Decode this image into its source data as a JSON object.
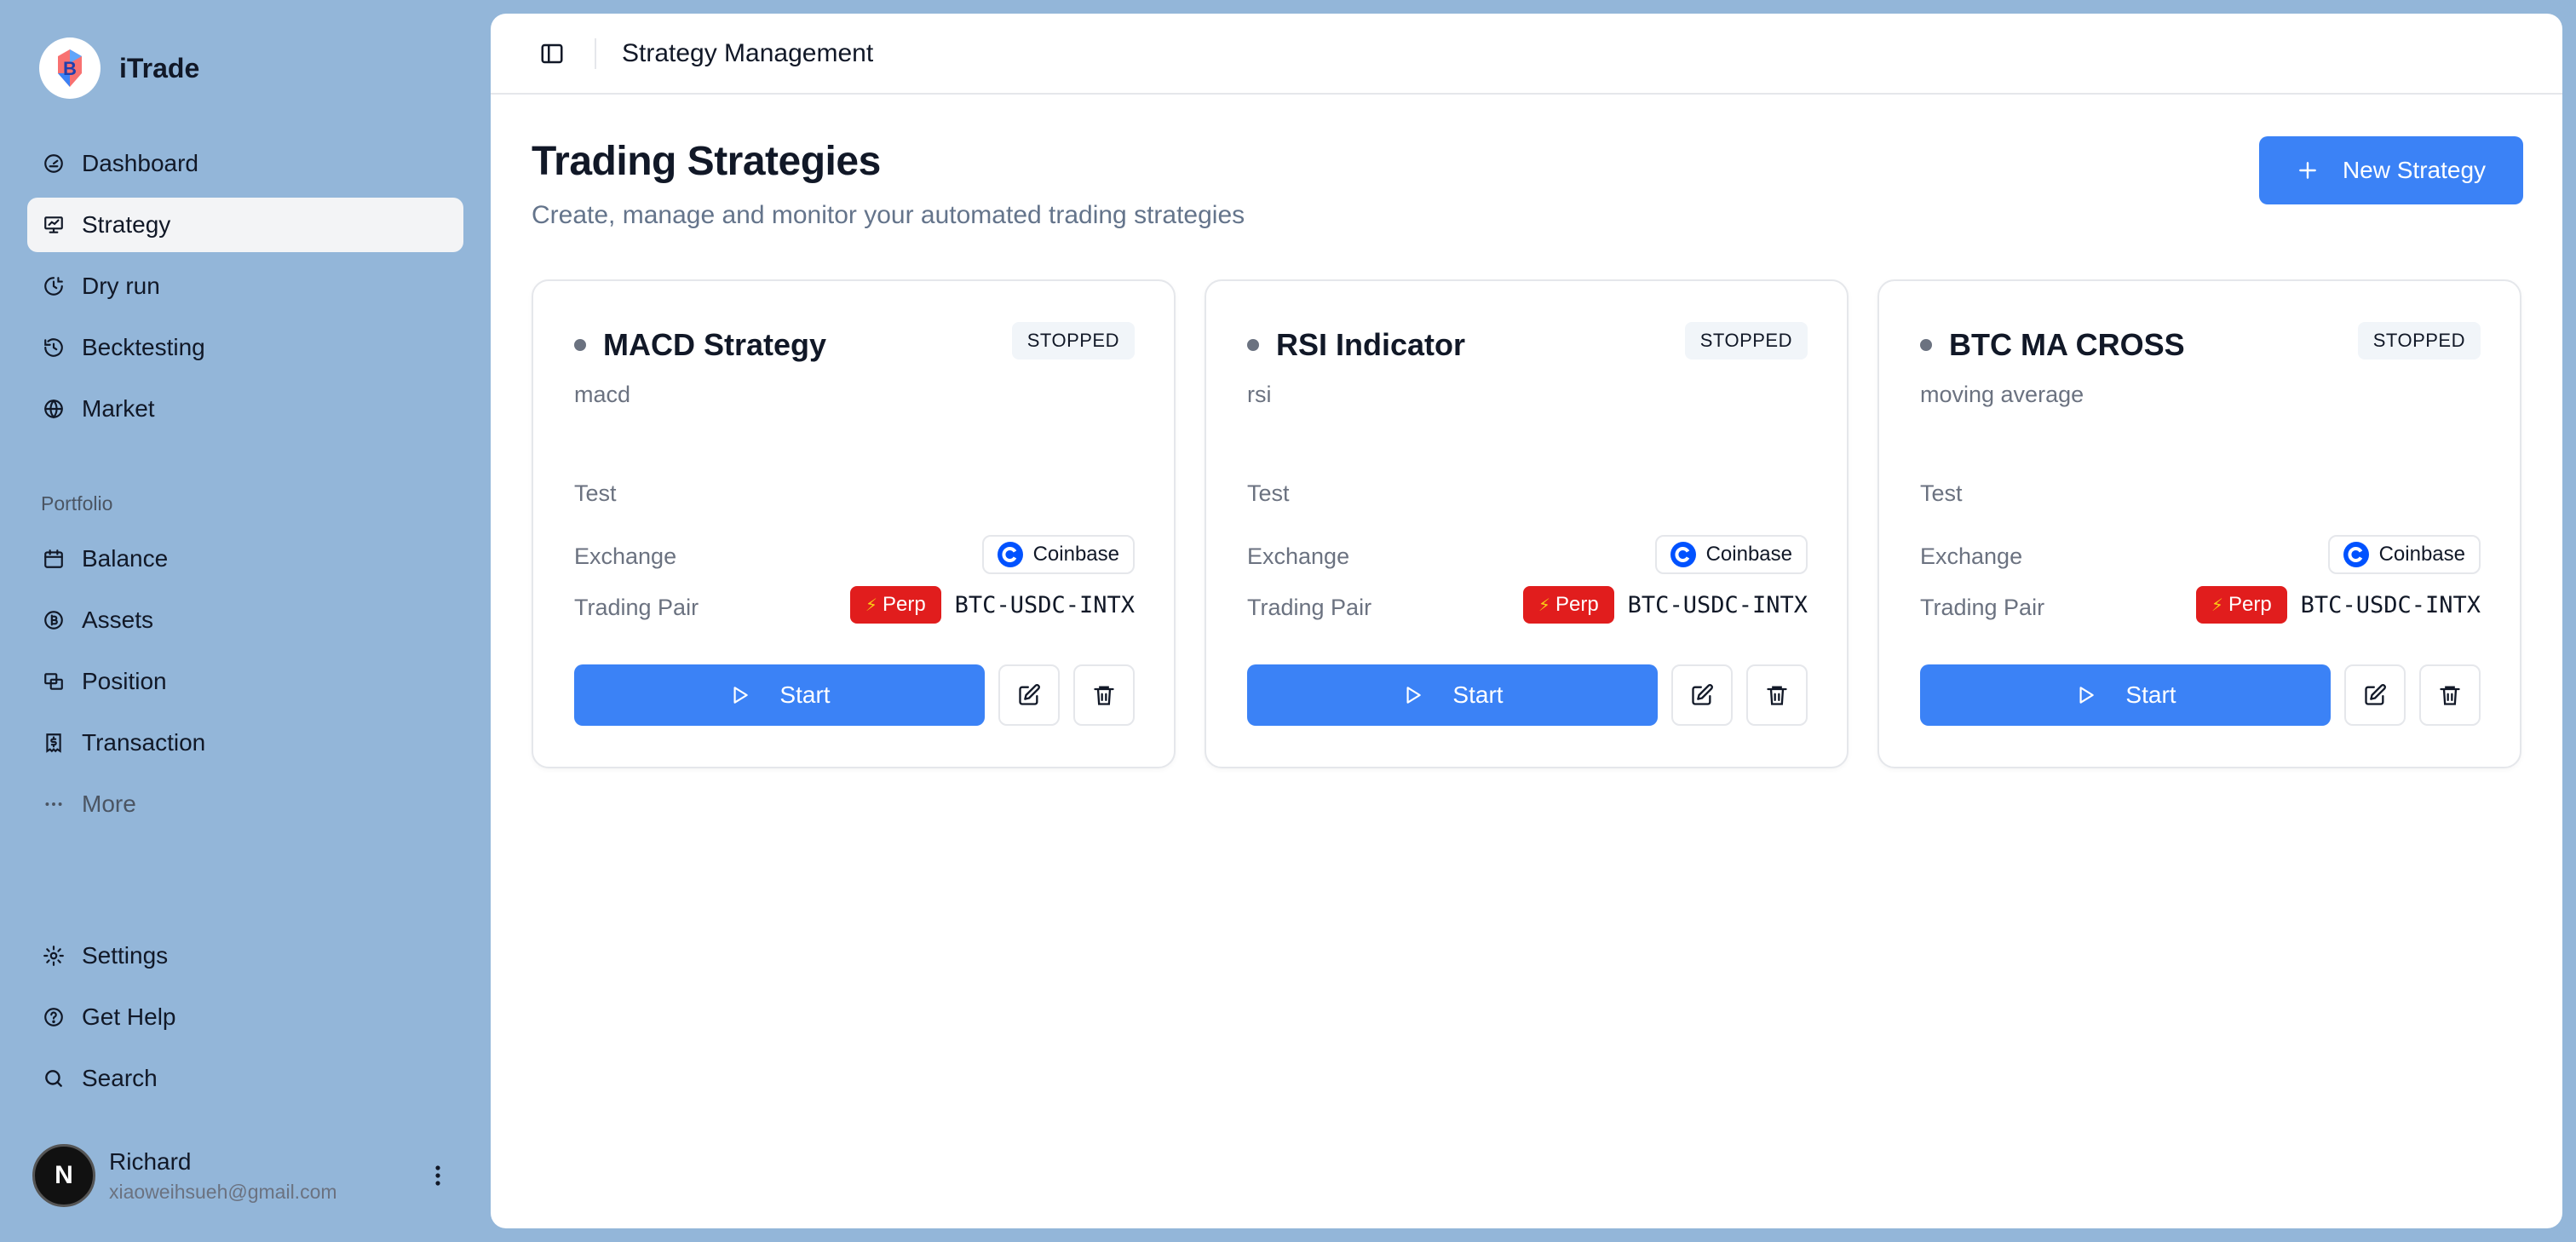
{
  "app": {
    "name": "iTrade"
  },
  "sidebar": {
    "primary": [
      {
        "label": "Dashboard",
        "icon": "gauge-icon"
      },
      {
        "label": "Strategy",
        "icon": "presentation-chart-icon",
        "active": true
      },
      {
        "label": "Dry run",
        "icon": "clock-chart-icon"
      },
      {
        "label": "Becktesting",
        "icon": "history-icon"
      },
      {
        "label": "Market",
        "icon": "globe-icon"
      }
    ],
    "portfolio_label": "Portfolio",
    "portfolio": [
      {
        "label": "Balance",
        "icon": "calendar-icon"
      },
      {
        "label": "Assets",
        "icon": "bitcoin-icon"
      },
      {
        "label": "Position",
        "icon": "stack-icon"
      },
      {
        "label": "Transaction",
        "icon": "receipt-icon"
      },
      {
        "label": "More",
        "icon": "ellipsis-icon"
      }
    ],
    "secondary": [
      {
        "label": "Settings",
        "icon": "gear-icon"
      },
      {
        "label": "Get Help",
        "icon": "help-circle-icon"
      },
      {
        "label": "Search",
        "icon": "search-icon"
      }
    ],
    "user": {
      "initial": "N",
      "name": "Richard",
      "email": "xiaoweihsueh@gmail.com"
    }
  },
  "header": {
    "title": "Strategy Management"
  },
  "page": {
    "title": "Trading Strategies",
    "subtitle": "Create, manage and monitor your automated trading strategies",
    "new_button": "New Strategy"
  },
  "labels": {
    "exchange": "Exchange",
    "trading_pair": "Trading Pair",
    "start": "Start",
    "perp": "Perp"
  },
  "strategies": [
    {
      "name": "MACD Strategy",
      "status": "STOPPED",
      "type": "macd",
      "tag": "Test",
      "exchange": "Coinbase",
      "pair": "BTC-USDC-INTX"
    },
    {
      "name": "RSI Indicator",
      "status": "STOPPED",
      "type": "rsi",
      "tag": "Test",
      "exchange": "Coinbase",
      "pair": "BTC-USDC-INTX"
    },
    {
      "name": "BTC MA CROSS",
      "status": "STOPPED",
      "type": "moving average",
      "tag": "Test",
      "exchange": "Coinbase",
      "pair": "BTC-USDC-INTX"
    }
  ],
  "colors": {
    "accent": "#3b82f6",
    "perp": "#e11d1d",
    "sidebar_bg": "#93b6d9",
    "coinbase": "#0052ff"
  }
}
